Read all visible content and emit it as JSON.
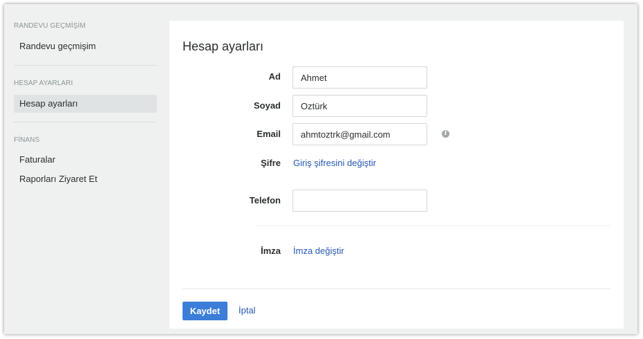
{
  "sidebar": {
    "sections": [
      {
        "header": "RANDEVU GEÇMİŞİM",
        "items": [
          {
            "label": "Randevu geçmişim",
            "active": false
          }
        ]
      },
      {
        "header": "HESAP AYARLARI",
        "items": [
          {
            "label": "Hesap ayarları",
            "active": true
          }
        ]
      },
      {
        "header": "FİNANS",
        "items": [
          {
            "label": "Faturalar",
            "active": false
          },
          {
            "label": "Raporları Ziyaret Et",
            "active": false
          }
        ]
      }
    ]
  },
  "main": {
    "title": "Hesap ayarları",
    "fields": {
      "ad": {
        "label": "Ad",
        "value": "Ahmet"
      },
      "soyad": {
        "label": "Soyad",
        "value": "Oztürk"
      },
      "email": {
        "label": "Email",
        "value": "ahmtoztrk@gmail.com",
        "info_icon": "info-icon"
      },
      "sifre": {
        "label": "Şifre",
        "link": "Giriş şifresini değiştir"
      },
      "telefon": {
        "label": "Telefon",
        "value": ""
      },
      "imza": {
        "label": "İmza",
        "link": "İmza değiştir"
      }
    },
    "actions": {
      "save_label": "Kaydet",
      "cancel_label": "İptal"
    }
  },
  "colors": {
    "accent": "#3b7dd8",
    "link": "#2458b3",
    "background": "#eef1f0"
  }
}
